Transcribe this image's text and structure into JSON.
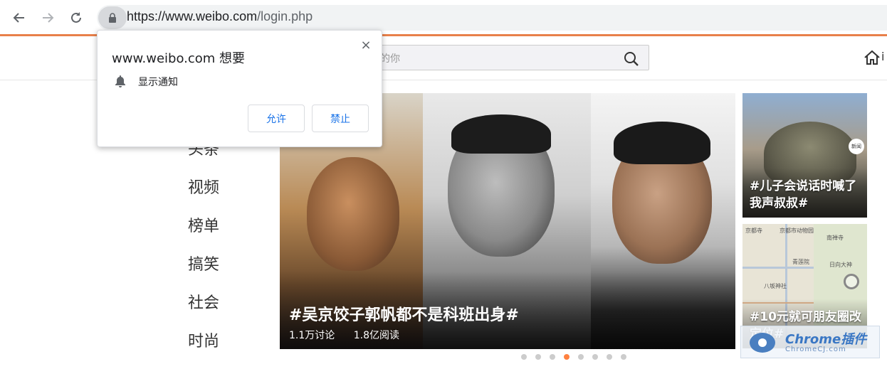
{
  "browser": {
    "url_host": "https://www.weibo.com",
    "url_path": "/login.php"
  },
  "permission_popup": {
    "title": "www.weibo.com 想要",
    "permission": "显示通知",
    "allow_label": "允许",
    "block_label": "禁止",
    "close_label": "×"
  },
  "header": {
    "search_placeholder": "的你",
    "home_extra": "i"
  },
  "left_nav": {
    "items": [
      "头条",
      "视频",
      "榜单",
      "搞笑",
      "社会",
      "时尚"
    ]
  },
  "hero": {
    "title": "#吴京饺子郭帆都不是科班出身#",
    "discussions": "1.1万讨论",
    "reads": "1.8亿阅读",
    "slide_count": 8,
    "active_slide": 4
  },
  "side_cards": [
    {
      "title": "#儿子会说话时喊了我声叔叔#",
      "badge": "新闻"
    },
    {
      "title": "#10元就可朋友圈改定位#"
    }
  ],
  "map_labels": [
    "京都市动物园",
    "青莲院",
    "八坂神社",
    "日向大神",
    "南禅寺",
    "京都寺"
  ],
  "watermark": {
    "text1": "Chrome插件",
    "text2": "ChromeCJ.com"
  },
  "colors": {
    "accent_orange": "#ff8140",
    "chrome_line": "#e8804a",
    "popup_button_text": "#1a73e8"
  }
}
